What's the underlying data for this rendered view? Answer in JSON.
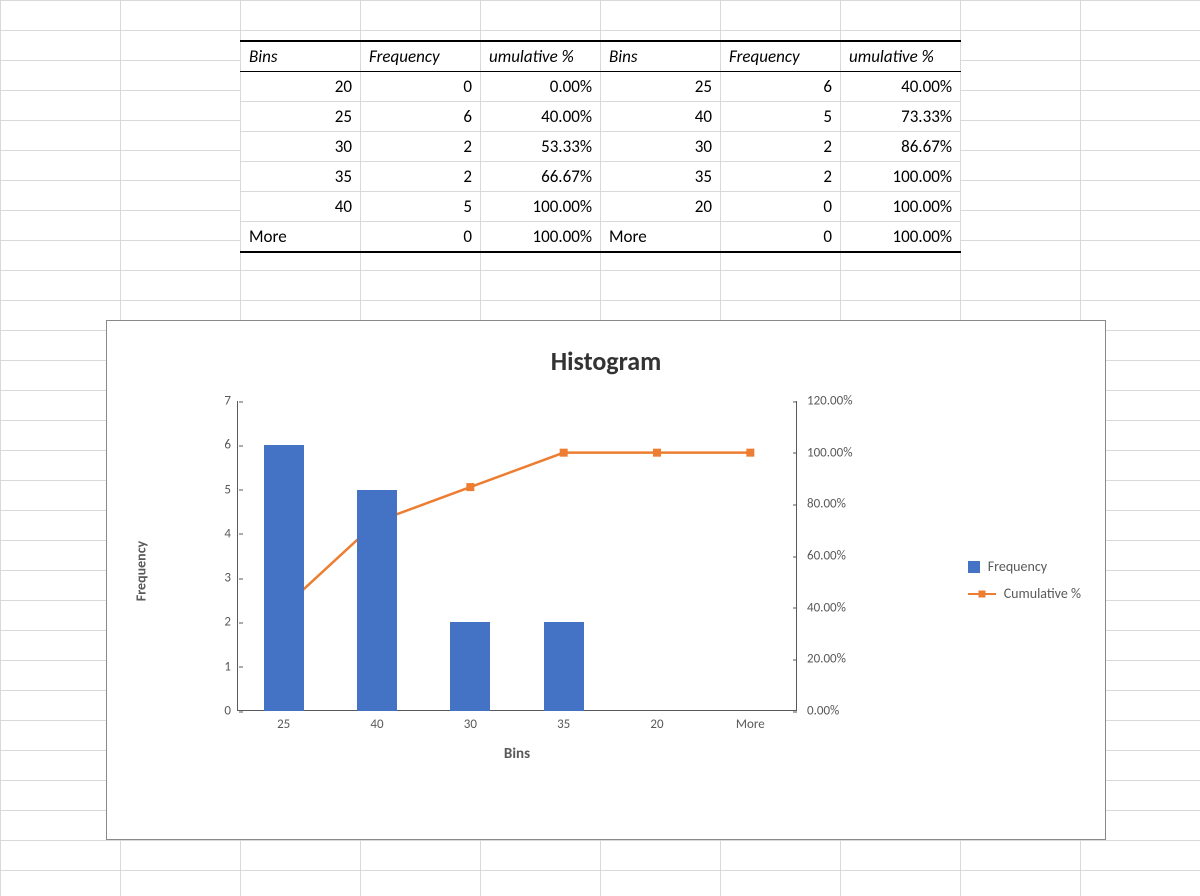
{
  "table": {
    "headers": [
      "Bins",
      "Frequency",
      "umulative %",
      "Bins",
      "Frequency",
      "umulative %"
    ],
    "rows": [
      [
        "20",
        "0",
        "0.00%",
        "25",
        "6",
        "40.00%"
      ],
      [
        "25",
        "6",
        "40.00%",
        "40",
        "5",
        "73.33%"
      ],
      [
        "30",
        "2",
        "53.33%",
        "30",
        "2",
        "86.67%"
      ],
      [
        "35",
        "2",
        "66.67%",
        "35",
        "2",
        "100.00%"
      ],
      [
        "40",
        "5",
        "100.00%",
        "20",
        "0",
        "100.00%"
      ],
      [
        "More",
        "0",
        "100.00%",
        "More",
        "0",
        "100.00%"
      ]
    ]
  },
  "chart": {
    "title": "Histogram",
    "xlabel": "Bins",
    "ylabel": "Frequency",
    "y_left_ticks": [
      "0",
      "1",
      "2",
      "3",
      "4",
      "5",
      "6",
      "7"
    ],
    "y_right_ticks": [
      "0.00%",
      "20.00%",
      "40.00%",
      "60.00%",
      "80.00%",
      "100.00%",
      "120.00%"
    ],
    "legend": {
      "series1": "Frequency",
      "series2": "Cumulative %"
    }
  },
  "chart_data": {
    "type": "bar",
    "title": "Histogram",
    "xlabel": "Bins",
    "ylabel": "Frequency",
    "y2label": "Cumulative %",
    "categories": [
      "25",
      "40",
      "30",
      "35",
      "20",
      "More"
    ],
    "ylim": [
      0,
      7
    ],
    "y2lim": [
      0,
      120
    ],
    "series": [
      {
        "name": "Frequency",
        "type": "bar",
        "axis": "left",
        "values": [
          6,
          5,
          2,
          2,
          0,
          0
        ]
      },
      {
        "name": "Cumulative %",
        "type": "line",
        "axis": "right",
        "values": [
          40.0,
          73.33,
          86.67,
          100.0,
          100.0,
          100.0
        ]
      }
    ],
    "colors": {
      "bar": "#4472c4",
      "line": "#ed7d31"
    }
  }
}
